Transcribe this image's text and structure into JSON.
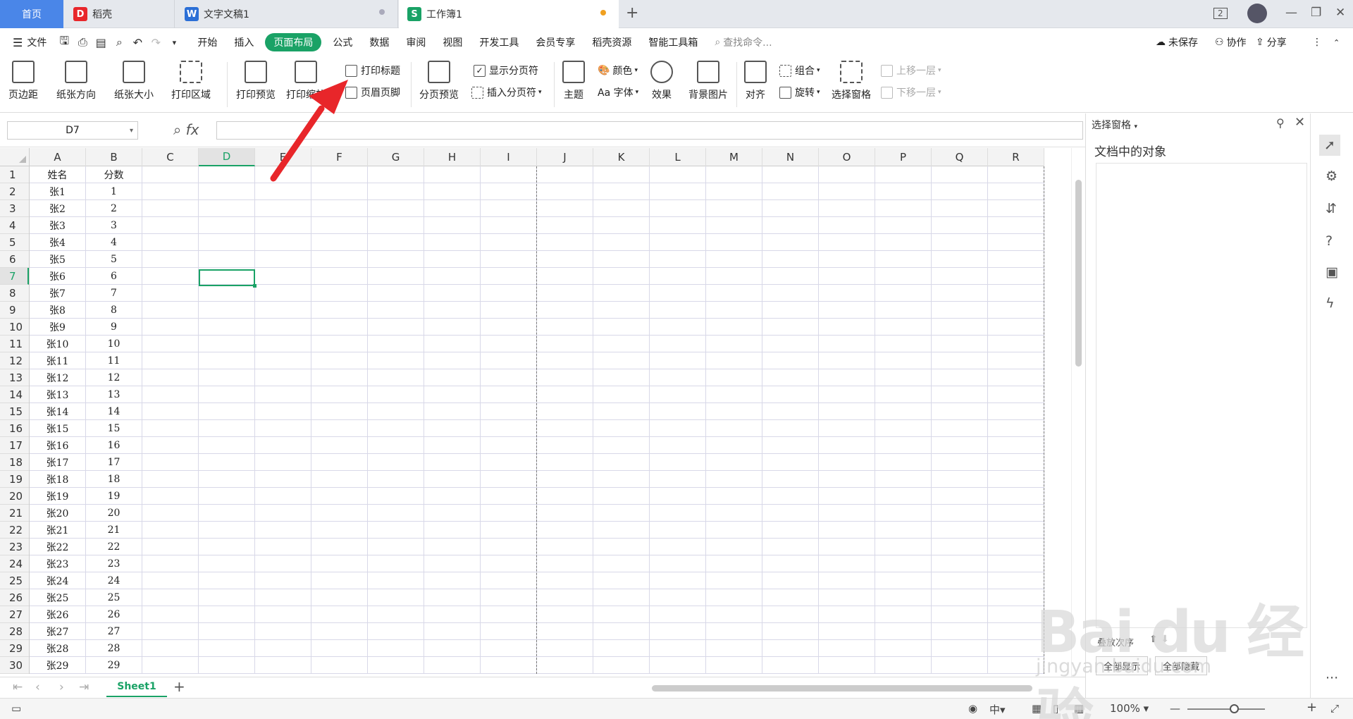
{
  "tabs": {
    "home": "首页",
    "daoke": "稻壳",
    "doc": "文字文稿1",
    "book": "工作簿1"
  },
  "window": {
    "badge": "2"
  },
  "menu": {
    "file": "文件",
    "items": [
      "开始",
      "插入",
      "页面布局",
      "公式",
      "数据",
      "审阅",
      "视图",
      "开发工具",
      "会员专享",
      "稻壳资源",
      "智能工具箱"
    ],
    "active": "页面布局",
    "search": "查找命令...",
    "unsaved": "未保存",
    "collab": "协作",
    "share": "分享"
  },
  "ribbon": {
    "margin": "页边距",
    "orientation": "纸张方向",
    "size": "纸张大小",
    "print_area": "打印区域",
    "print_preview": "打印预览",
    "print_scale": "打印缩放",
    "print_title": "打印标题",
    "header_footer": "页眉页脚",
    "page_break_preview": "分页预览",
    "show_breaks": "显示分页符",
    "insert_break": "插入分页符",
    "theme": "主题",
    "color": "颜色",
    "font": "Aa 字体",
    "effect": "效果",
    "background": "背景图片",
    "align": "对齐",
    "group": "组合",
    "rotate": "旋转",
    "selection_pane": "选择窗格",
    "bring_forward": "上移一层",
    "send_backward": "下移一层"
  },
  "formula": {
    "name_box": "D7",
    "fx": "fx",
    "value": ""
  },
  "grid": {
    "columns": [
      "A",
      "B",
      "C",
      "D",
      "E",
      "F",
      "G",
      "H",
      "I",
      "J",
      "K",
      "L",
      "M",
      "N",
      "O",
      "P",
      "Q",
      "R"
    ],
    "selected_column": "D",
    "selected_row": "7",
    "rows": [
      [
        "1",
        "姓名",
        "分数"
      ],
      [
        "2",
        "张1",
        "1"
      ],
      [
        "3",
        "张2",
        "2"
      ],
      [
        "4",
        "张3",
        "3"
      ],
      [
        "5",
        "张4",
        "4"
      ],
      [
        "6",
        "张5",
        "5"
      ],
      [
        "7",
        "张6",
        "6"
      ],
      [
        "8",
        "张7",
        "7"
      ],
      [
        "9",
        "张8",
        "8"
      ],
      [
        "10",
        "张9",
        "9"
      ],
      [
        "11",
        "张10",
        "10"
      ],
      [
        "12",
        "张11",
        "11"
      ],
      [
        "13",
        "张12",
        "12"
      ],
      [
        "14",
        "张13",
        "13"
      ],
      [
        "15",
        "张14",
        "14"
      ],
      [
        "16",
        "张15",
        "15"
      ],
      [
        "17",
        "张16",
        "16"
      ],
      [
        "18",
        "张17",
        "17"
      ],
      [
        "19",
        "张18",
        "18"
      ],
      [
        "20",
        "张19",
        "19"
      ],
      [
        "21",
        "张20",
        "20"
      ],
      [
        "22",
        "张21",
        "21"
      ],
      [
        "23",
        "张22",
        "22"
      ],
      [
        "24",
        "张23",
        "23"
      ],
      [
        "25",
        "张24",
        "24"
      ],
      [
        "26",
        "张25",
        "25"
      ],
      [
        "27",
        "张26",
        "26"
      ],
      [
        "28",
        "张27",
        "27"
      ],
      [
        "29",
        "张28",
        "28"
      ],
      [
        "30",
        "张29",
        "29"
      ]
    ]
  },
  "sheet_tab": "Sheet1",
  "status": {
    "zoom": "100%"
  },
  "side_panel": {
    "title": "选择窗格",
    "subtitle": "文档中的对象",
    "sort_label": "叠放次序",
    "show_all": "全部显示",
    "hide_all": "全部隐藏"
  },
  "watermark": {
    "brand": "Bai du 经验",
    "url": "jingyan.baidu.com"
  },
  "colors": {
    "accent": "#1aa266",
    "home_tab": "#4a86e8",
    "arrow": "#e8262a"
  }
}
